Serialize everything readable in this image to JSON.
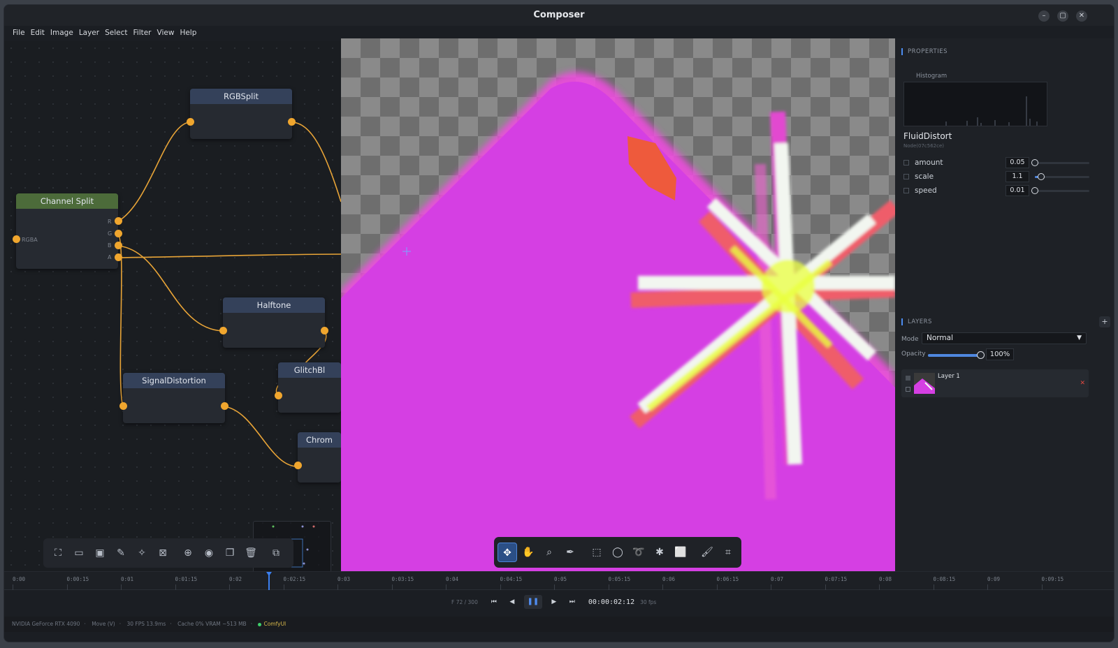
{
  "window": {
    "title": "Composer"
  },
  "menu": [
    "File",
    "Edit",
    "Image",
    "Layer",
    "Select",
    "Filter",
    "View",
    "Help"
  ],
  "nodes": {
    "rgbsplit": "RGBSplit",
    "channel_split": "Channel Split",
    "halftone": "Halftone",
    "signal_distortion": "SignalDistortion",
    "glitch": "GlitchBl",
    "chrom": "Chrom",
    "ports": {
      "rgba": "RGBA",
      "r": "R",
      "g": "G",
      "b": "B",
      "a": "A"
    }
  },
  "node_toolbar_icons": [
    "shapes-icon",
    "frame-icon",
    "image-icon",
    "pencil-icon",
    "sparkle-icon",
    "collapse-icon",
    "add-icon",
    "eye-icon",
    "copy-icon",
    "trash-icon",
    "fit-icon"
  ],
  "canvas_tools": [
    {
      "name": "move-tool",
      "active": true
    },
    {
      "name": "hand-tool",
      "active": false
    },
    {
      "name": "zoom-tool",
      "active": false
    },
    {
      "name": "eyedropper-tool",
      "active": false
    },
    {
      "name": "rect-select-tool",
      "active": false
    },
    {
      "name": "ellipse-select-tool",
      "active": false
    },
    {
      "name": "lasso-tool",
      "active": false
    },
    {
      "name": "magic-wand-tool",
      "active": false
    },
    {
      "name": "marquee-tool",
      "active": false
    },
    {
      "name": "brush-tool",
      "active": false
    },
    {
      "name": "crop-tool",
      "active": false
    }
  ],
  "properties": {
    "section_title": "PROPERTIES",
    "histogram_label": "Histogram",
    "node_name": "FluidDistort",
    "node_id": "Node(07c562ce)",
    "params": [
      {
        "name": "amount",
        "value": "0.05",
        "fraction": 0.0
      },
      {
        "name": "scale",
        "value": "1.1",
        "fraction": 0.12
      },
      {
        "name": "speed",
        "value": "0.01",
        "fraction": 0.0
      }
    ]
  },
  "layers": {
    "section_title": "LAYERS",
    "add_label": "+",
    "mode_label": "Mode",
    "mode_value": "Normal",
    "opacity_label": "Opacity",
    "opacity_value": "100%",
    "opacity_fraction": 1.0,
    "items": [
      {
        "name": "Layer 1"
      }
    ]
  },
  "timeline": {
    "ticks": [
      "0:00",
      "0:00:15",
      "0:01",
      "0:01:15",
      "0:02",
      "0:02:15",
      "0:03",
      "0:03:15",
      "0:04",
      "0:04:15",
      "0:05",
      "0:05:15",
      "0:06",
      "0:06:15",
      "0:07",
      "0:07:15",
      "0:08",
      "0:08:15",
      "0:09",
      "0:09:15"
    ],
    "frame": "F 72 / 300",
    "timecode": "00:00:02:12",
    "fps": "30 fps"
  },
  "status": {
    "gpu": "NVIDIA GeForce RTX 4090",
    "tool": "Move (V)",
    "perf": "30 FPS  13.9ms",
    "cache": "Cache 0%  VRAM ~513 MB",
    "connection": "ComfyUI"
  },
  "colors": {
    "accent": "#4c8cf0",
    "port": "#f0a62e",
    "magenta": "#d43be6",
    "wire": "#e8a437"
  }
}
